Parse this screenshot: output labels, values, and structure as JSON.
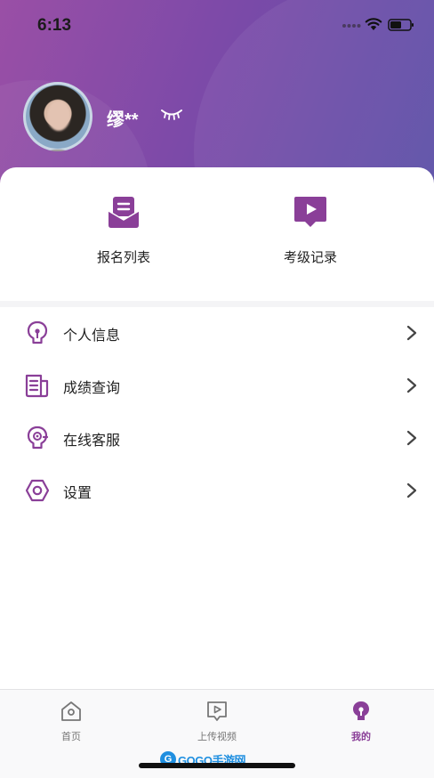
{
  "status": {
    "time": "6:13"
  },
  "profile": {
    "name": "缪**"
  },
  "quick_actions": [
    {
      "label": "报名列表",
      "icon": "envelope-icon"
    },
    {
      "label": "考级记录",
      "icon": "video-record-icon"
    }
  ],
  "menu": [
    {
      "label": "个人信息",
      "icon": "person-info-icon"
    },
    {
      "label": "成绩查询",
      "icon": "document-icon"
    },
    {
      "label": "在线客服",
      "icon": "headset-icon"
    },
    {
      "label": "设置",
      "icon": "settings-icon"
    }
  ],
  "tabs": [
    {
      "label": "首页",
      "icon": "home-icon",
      "active": false
    },
    {
      "label": "上传视频",
      "icon": "upload-video-icon",
      "active": false
    },
    {
      "label": "我的",
      "icon": "profile-icon",
      "active": true
    }
  ],
  "watermark": {
    "logo": "G",
    "text": "GOGO手游网"
  },
  "colors": {
    "accent": "#8a3f98",
    "header_start": "#9a4fa6",
    "header_end": "#5a4ea6"
  }
}
